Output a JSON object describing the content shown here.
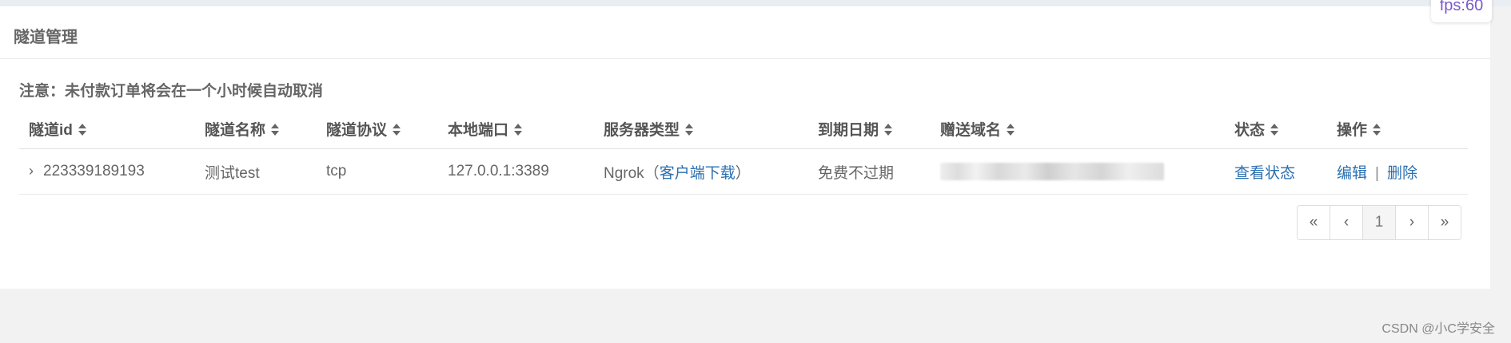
{
  "panel": {
    "title": "隧道管理",
    "notice": "注意：未付款订单将会在一个小时候自动取消"
  },
  "table": {
    "columns": [
      "隧道id",
      "隧道名称",
      "隧道协议",
      "本地端口",
      "服务器类型",
      "到期日期",
      "赠送域名",
      "状态",
      "操作"
    ],
    "rows": [
      {
        "id": "223339189193",
        "name": "测试test",
        "protocol": "tcp",
        "local_port": "127.0.0.1:3389",
        "server_type_prefix": "Ngrok（",
        "server_type_link": "客户端下载",
        "server_type_suffix": "）",
        "expiry": "免费不过期",
        "status_link": "查看状态",
        "edit_label": "编辑",
        "separator": "|",
        "delete_label": "删除"
      }
    ]
  },
  "pagination": {
    "first": "«",
    "prev": "‹",
    "current": "1",
    "next": "›",
    "last": "»"
  },
  "overlay": {
    "fps": "fps:60"
  },
  "watermark": "CSDN @小C学安全",
  "colors": {
    "link": "#2a6fb0",
    "fps": "#7a5acb"
  }
}
